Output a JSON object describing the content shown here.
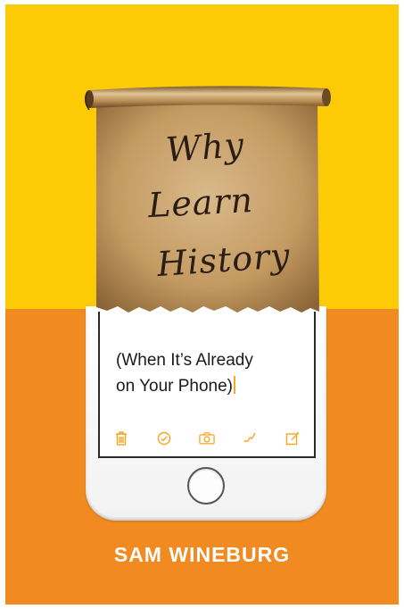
{
  "cover": {
    "title_lines": [
      "Why",
      "Learn",
      "History"
    ],
    "subtitle_line1": "(When It’s Already",
    "subtitle_line2": "on Your Phone)",
    "author": "SAM WINEBURG"
  },
  "colors": {
    "top_band": "#fccb05",
    "bottom_band": "#f08a21",
    "parchment": "#c9a26d",
    "toolbar_icons": "#f5a623"
  },
  "phone": {
    "toolbar_icons": [
      "trash-icon",
      "checkmark-icon",
      "camera-icon",
      "sketch-icon",
      "compose-icon"
    ]
  }
}
